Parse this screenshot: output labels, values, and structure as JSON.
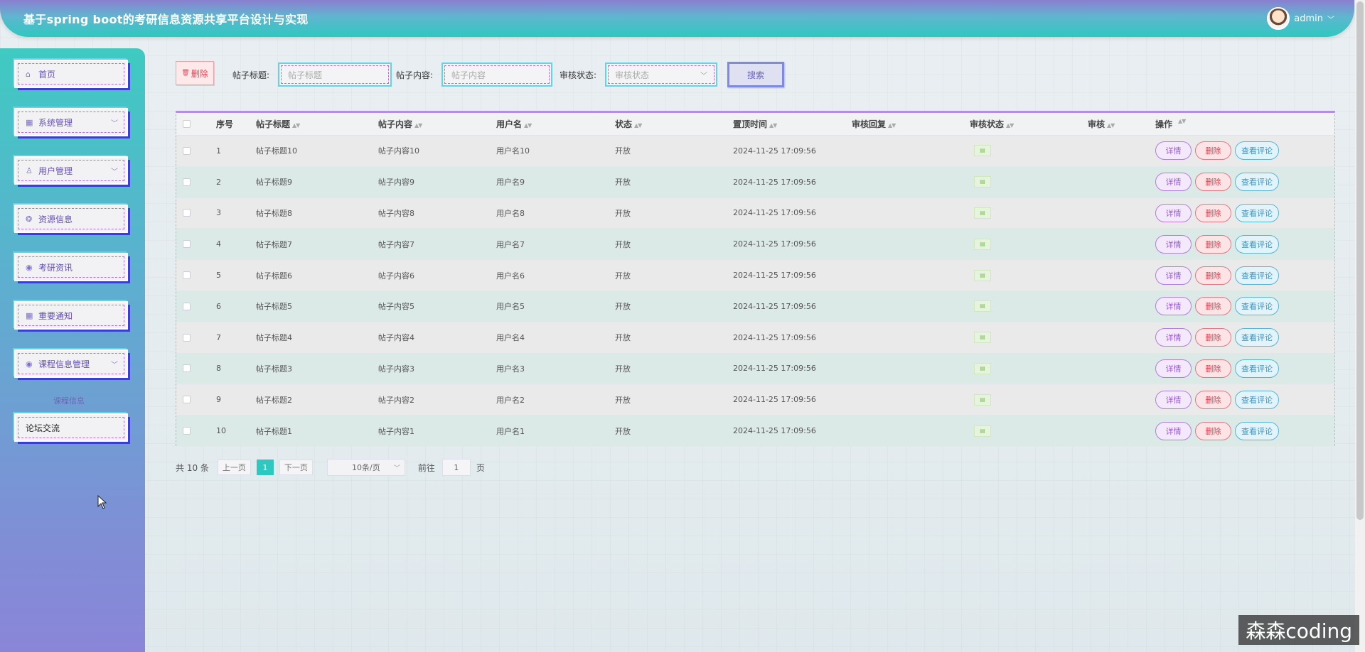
{
  "header": {
    "title": "基于spring boot的考研信息资源共享平台设计与实现",
    "user": "admin"
  },
  "sidebar": {
    "items": [
      {
        "label": "首页",
        "icon": "home-icon"
      },
      {
        "label": "系统管理",
        "icon": "grid-icon",
        "expandable": true
      },
      {
        "label": "用户管理",
        "icon": "user-icon",
        "expandable": true
      },
      {
        "label": "资源信息",
        "icon": "globe-icon"
      },
      {
        "label": "考研资讯",
        "icon": "circle-icon"
      },
      {
        "label": "重要通知",
        "icon": "grid-icon"
      },
      {
        "label": "课程信息管理",
        "icon": "circle-icon",
        "expandable": true
      }
    ],
    "sub_label": "课程信息",
    "active_item": "论坛交流"
  },
  "toolbar": {
    "delete_label": "删除",
    "title_label": "帖子标题:",
    "title_placeholder": "帖子标题",
    "content_label": "帖子内容:",
    "content_placeholder": "帖子内容",
    "status_label": "审核状态:",
    "status_placeholder": "审核状态",
    "search_label": "搜索"
  },
  "table": {
    "headers": [
      "序号",
      "帖子标题",
      "帖子内容",
      "用户名",
      "状态",
      "置顶时间",
      "审核回复",
      "审核状态",
      "审核",
      "操作"
    ],
    "rows": [
      {
        "no": "1",
        "title": "帖子标题10",
        "content": "帖子内容10",
        "user": "用户名10",
        "status": "开放",
        "time": "2024-11-25 17:09:56"
      },
      {
        "no": "2",
        "title": "帖子标题9",
        "content": "帖子内容9",
        "user": "用户名9",
        "status": "开放",
        "time": "2024-11-25 17:09:56"
      },
      {
        "no": "3",
        "title": "帖子标题8",
        "content": "帖子内容8",
        "user": "用户名8",
        "status": "开放",
        "time": "2024-11-25 17:09:56"
      },
      {
        "no": "4",
        "title": "帖子标题7",
        "content": "帖子内容7",
        "user": "用户名7",
        "status": "开放",
        "time": "2024-11-25 17:09:56"
      },
      {
        "no": "5",
        "title": "帖子标题6",
        "content": "帖子内容6",
        "user": "用户名6",
        "status": "开放",
        "time": "2024-11-25 17:09:56"
      },
      {
        "no": "6",
        "title": "帖子标题5",
        "content": "帖子内容5",
        "user": "用户名5",
        "status": "开放",
        "time": "2024-11-25 17:09:56"
      },
      {
        "no": "7",
        "title": "帖子标题4",
        "content": "帖子内容4",
        "user": "用户名4",
        "status": "开放",
        "time": "2024-11-25 17:09:56"
      },
      {
        "no": "8",
        "title": "帖子标题3",
        "content": "帖子内容3",
        "user": "用户名3",
        "status": "开放",
        "time": "2024-11-25 17:09:56"
      },
      {
        "no": "9",
        "title": "帖子标题2",
        "content": "帖子内容2",
        "user": "用户名2",
        "status": "开放",
        "time": "2024-11-25 17:09:56"
      },
      {
        "no": "10",
        "title": "帖子标题1",
        "content": "帖子内容1",
        "user": "用户名1",
        "status": "开放",
        "time": "2024-11-25 17:09:56"
      }
    ],
    "ops": {
      "detail": "详情",
      "delete": "删除",
      "comments": "查看评论"
    }
  },
  "pagination": {
    "total": "共 10 条",
    "prev": "上一页",
    "current": "1",
    "next": "下一页",
    "page_size": "10条/页",
    "goto_label": "前往",
    "goto_value": "1",
    "page_suffix": "页"
  },
  "watermark": "森森coding",
  "colors": {
    "header_gradient_top": "#8b7fd0",
    "header_gradient_bottom": "#2ec8c0",
    "accent": "#2ec8c0",
    "detail": "#9b58d8",
    "danger": "#d8404f",
    "info": "#3b94c5"
  }
}
